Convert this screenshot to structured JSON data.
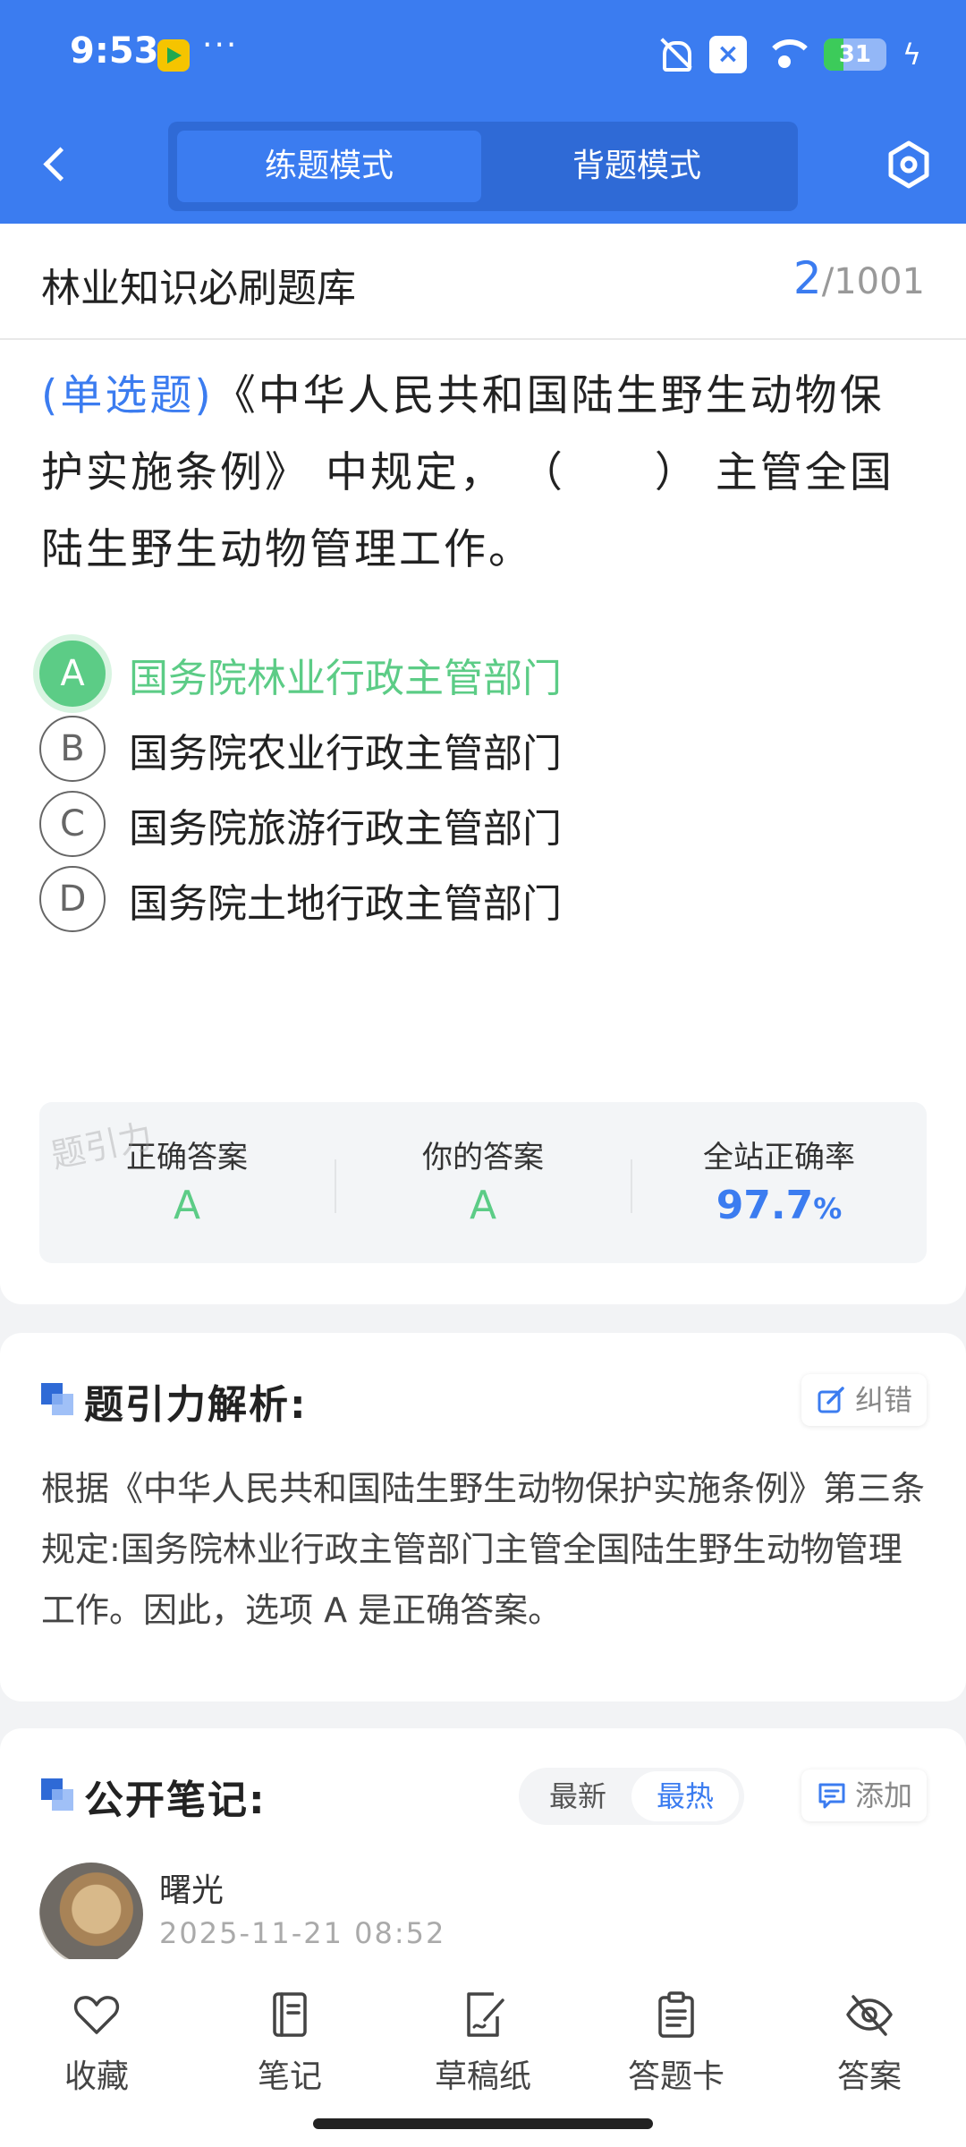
{
  "status_bar": {
    "time": "9:53",
    "more": "···",
    "battery": "31",
    "battery_level": 0.31
  },
  "header": {
    "tabs": [
      {
        "label": "练题模式",
        "active": true
      },
      {
        "label": "背题模式",
        "active": false
      }
    ]
  },
  "question": {
    "bank_title": "林业知识必刷题库",
    "current": "2",
    "total_sep": "/",
    "total": "1001",
    "type_label": "(单选题)",
    "text": "《中华人民共和国陆生野生动物保护实施条例》 中规定， （　　） 主管全国陆生野生动物管理工作。",
    "options": [
      {
        "letter": "A",
        "text": "国务院林业行政主管部门",
        "correct": true
      },
      {
        "letter": "B",
        "text": "国务院农业行政主管部门",
        "correct": false
      },
      {
        "letter": "C",
        "text": "国务院旅游行政主管部门",
        "correct": false
      },
      {
        "letter": "D",
        "text": "国务院土地行政主管部门",
        "correct": false
      }
    ],
    "stats": {
      "correct_label": "正确答案",
      "correct_value": "A",
      "yours_label": "你的答案",
      "yours_value": "A",
      "rate_label": "全站正确率",
      "rate_value": "97.7",
      "rate_unit": "%"
    },
    "watermark": "题引力"
  },
  "analysis": {
    "title": "题引力解析:",
    "report_label": "纠错",
    "text": "根据《中华人民共和国陆生野生动物保护实施条例》第三条规定:国务院林业行政主管部门主管全国陆生野生动物管理工作。因此，选项 A 是正确答案。"
  },
  "notes": {
    "title": "公开笔记:",
    "sort_tabs": [
      {
        "label": "最新",
        "active": false
      },
      {
        "label": "最热",
        "active": true
      }
    ],
    "add_label": "添加",
    "user_name": "曙光",
    "time": "2025-11-21 08:52"
  },
  "bottom_nav": [
    {
      "label": "收藏",
      "icon": "heart-icon"
    },
    {
      "label": "笔记",
      "icon": "notebook-icon"
    },
    {
      "label": "草稿纸",
      "icon": "draft-icon"
    },
    {
      "label": "答题卡",
      "icon": "clipboard-icon"
    },
    {
      "label": "答案",
      "icon": "eye-off-icon"
    }
  ],
  "colors": {
    "primary": "#3b7cf0",
    "correct": "#5ccc86",
    "background": "#f2f3f5"
  }
}
